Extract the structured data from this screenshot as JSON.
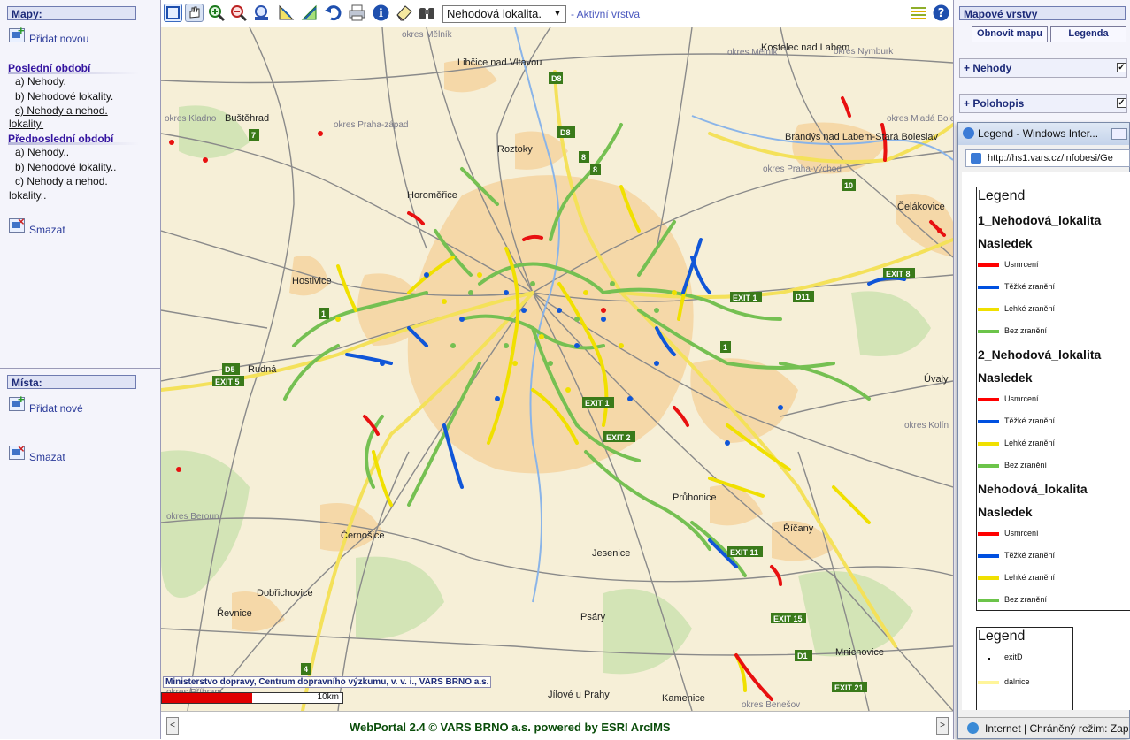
{
  "left_panel": {
    "maps_header": "Mapy:",
    "add_new": "Přidat novou",
    "last_period": "Poslední období",
    "last_items": [
      "a) Nehody.",
      "b) Nehodové lokality.",
      "c) Nehody a nehod.",
      "lokality."
    ],
    "prev_period": "Předposlední období",
    "prev_items": [
      "a) Nehody..",
      "b) Nehodové lokality..",
      "c) Nehody a nehod.",
      "lokality.."
    ],
    "delete": "Smazat",
    "places_header": "Místa:",
    "add_place": "Přidat nové",
    "delete_place": "Smazat"
  },
  "toolbar": {
    "layer_select_value": "Nehodová lokalita.",
    "active_layer_label": "- Aktivní vrstva",
    "tools": [
      "full-extent-icon",
      "pan-hand-icon",
      "zoom-in-icon",
      "zoom-out-icon",
      "zoom-to-layer-icon",
      "measure-icon",
      "measure-area-icon",
      "undo-icon",
      "print-icon",
      "info-icon",
      "clear-icon",
      "binoculars-icon",
      "legend-icon",
      "help-icon"
    ]
  },
  "map": {
    "attribution": "Ministerstvo dopravy, Centrum dopravního výzkumu, v. v. i., VARS BRNO a.s.",
    "scale_label": "10km",
    "places": [
      "Mělník",
      "Libčice nad Vltavou",
      "Kostelec nad Labem",
      "Buštěhrad",
      "Roztoky",
      "Brandýs nad Labem-Stará Boleslav",
      "Horoměřice",
      "Čelákovice",
      "Hostivice",
      "Rudná",
      "Úvaly",
      "Průhonice",
      "Černošice",
      "Jesenice",
      "Říčany",
      "Dobřichovice",
      "Řevnice",
      "Psáry",
      "Mnichovice",
      "Jílové u Prahy",
      "Kamenice"
    ],
    "okres_labels": [
      "okres Mělník",
      "okres Mělník",
      "okres Kladno",
      "okres Praha-západ",
      "okres Praha-východ",
      "okres Beroun",
      "okres Kolín",
      "okres Benešov",
      "okres Příbram",
      "okres Mladá Boleslav",
      "okres Nymburk"
    ],
    "exits": [
      "EXIT 1",
      "EXIT 5",
      "EXIT 8",
      "EXIT 1",
      "EXIT 2",
      "EXIT 11",
      "EXIT 15",
      "EXIT 21"
    ],
    "route_shields": [
      "D8",
      "D8",
      "D11",
      "D5",
      "D1",
      "7",
      "8",
      "8",
      "10",
      "1",
      "1",
      "4"
    ]
  },
  "footer": {
    "text": "WebPortal 2.4 © VARS BRNO a.s.   powered by ESRI ArcIMS"
  },
  "right_panel": {
    "header": "Mapové vrstvy",
    "refresh_button": "Obnovit mapu",
    "legend_button": "Legenda",
    "layers": [
      {
        "name": "+ Nehody",
        "checked": true
      },
      {
        "name": "+ Polohopis",
        "checked": true
      }
    ]
  },
  "popup": {
    "title": "Legend - Windows Inter...",
    "url": "http://hs1.vars.cz/infobesi/Ge",
    "legend_title": "Legend",
    "groups": [
      {
        "layer": "1_Nehodová_lokalita",
        "field": "Nasledek"
      },
      {
        "layer": "2_Nehodová_lokalita",
        "field": "Nasledek"
      },
      {
        "layer": "Nehodová_lokalita",
        "field": "Nasledek"
      }
    ],
    "classes": [
      {
        "label": "Usmrcení",
        "color": "#ff0000"
      },
      {
        "label": "Těžké zranění",
        "color": "#0050e0"
      },
      {
        "label": "Lehké zranění",
        "color": "#f0e000"
      },
      {
        "label": "Bez zranění",
        "color": "#6cc44a"
      }
    ],
    "legend2_title": "Legend",
    "legend2_items": [
      "exitD",
      "dalnice"
    ],
    "status": "Internet | Chráněný režim: Zap"
  }
}
